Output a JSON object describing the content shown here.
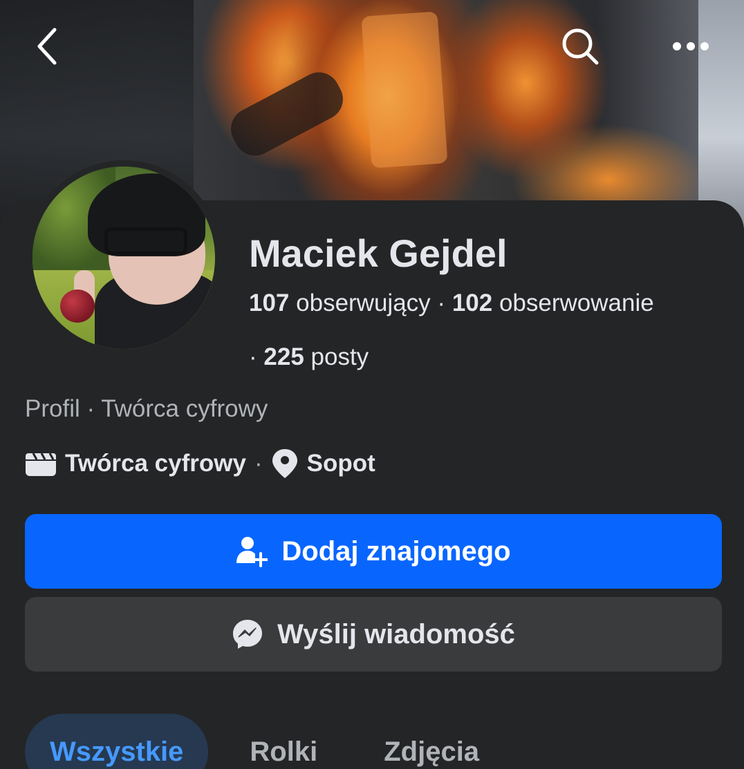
{
  "header": {
    "back_icon": "chevron-left-icon",
    "search_icon": "search-icon",
    "more_icon": "more-horizontal-icon"
  },
  "profile": {
    "name": "Maciek Gejdel",
    "followers_count": "107",
    "followers_label": "obserwujący",
    "following_count": "102",
    "following_label": "obserwowanie",
    "posts_count": "225",
    "posts_label": "posty",
    "dot": "·",
    "subtitle": "Profil · Twórca cyfrowy",
    "category": "Twórca cyfrowy",
    "location": "Sopot",
    "category_icon": "clapperboard-icon",
    "location_icon": "map-pin-icon"
  },
  "actions": {
    "add_friend_label": "Dodaj znajomego",
    "add_friend_icon": "person-add-icon",
    "message_label": "Wyślij wiadomość",
    "message_icon": "messenger-icon"
  },
  "tabs": [
    {
      "label": "Wszystkie",
      "active": true
    },
    {
      "label": "Rolki",
      "active": false
    },
    {
      "label": "Zdjęcia",
      "active": false
    }
  ],
  "colors": {
    "background": "#242526",
    "primary_button": "#0866ff",
    "secondary_button": "#3a3b3c",
    "active_tab_bg": "#263951",
    "active_tab_text": "#4599ff",
    "secondary_text": "#b0b3b8"
  }
}
